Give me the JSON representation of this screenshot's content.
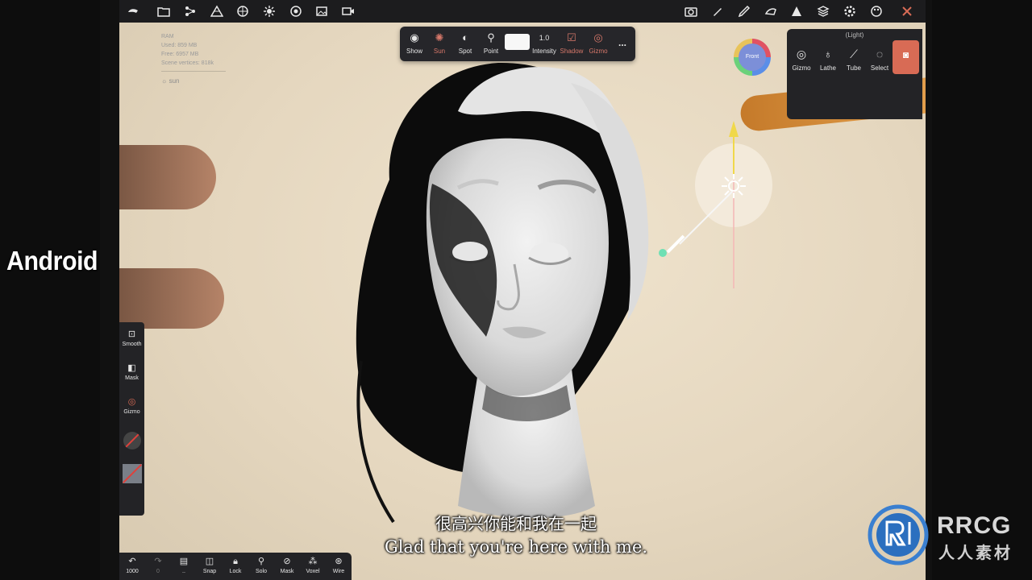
{
  "stats": {
    "ram": "RAM",
    "used": "Used: 859 MB",
    "free": "Free: 6957 MB",
    "vertices": "Scene vertices: 818k",
    "light_name": "sun"
  },
  "light_toolbar": {
    "show": "Show",
    "sun": "Sun",
    "spot": "Spot",
    "point": "Point",
    "intensity_value": "1.0",
    "intensity": "Intensity",
    "shadow": "Shadow",
    "gizmo": "Gizmo",
    "more": "..."
  },
  "right_panel": {
    "title": "(Light)",
    "gizmo": "Gizmo",
    "lathe": "Lathe",
    "tube": "Tube",
    "select": "Select"
  },
  "view_cube_label": "Front",
  "left_toolbar": {
    "smooth": "Smooth",
    "mask": "Mask",
    "gizmo": "Gizmo"
  },
  "bottom_toolbar": {
    "undo_count": "1000",
    "redo_count": "0",
    "snap": "Snap",
    "lock": "Lock",
    "solo": "Solo",
    "mask": "Mask",
    "voxel": "Voxel",
    "wire": "Wire"
  },
  "overlay_label": "Android",
  "subtitle": {
    "chinese": "很高兴你能和我在一起",
    "english": "Glad that you're here with me."
  },
  "watermark": {
    "brand": "RRCG",
    "brand_cn": "人人素材"
  },
  "colors": {
    "toolbar_bg": "#232326",
    "accent": "#d86b55",
    "viewport_bg": "#e8dcc6",
    "gizmo_yellow": "#f0d84a"
  }
}
